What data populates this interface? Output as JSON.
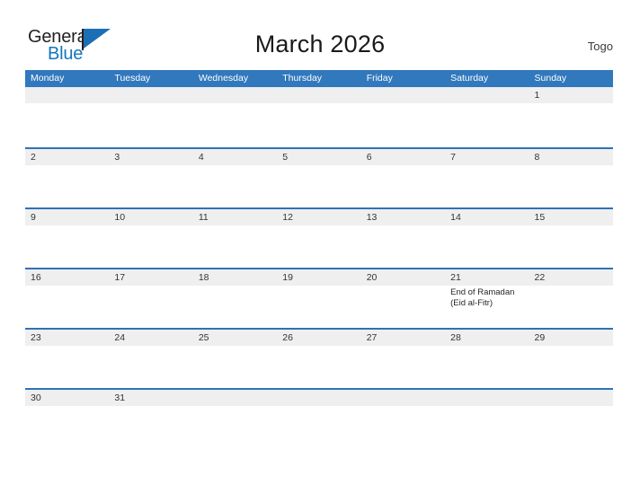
{
  "header": {
    "logo_primary": "General",
    "logo_secondary": "Blue",
    "title": "March 2026",
    "country": "Togo"
  },
  "colors": {
    "header_blue": "#3178bd",
    "row_divider_blue": "#2f72b5",
    "daynum_band": "#efeff0",
    "logo_blue": "#1276bd",
    "text_dark": "#333333"
  },
  "calendar": {
    "weekdays": [
      "Monday",
      "Tuesday",
      "Wednesday",
      "Thursday",
      "Friday",
      "Saturday",
      "Sunday"
    ],
    "weeks": [
      {
        "days": [
          {
            "num": "",
            "event": ""
          },
          {
            "num": "",
            "event": ""
          },
          {
            "num": "",
            "event": ""
          },
          {
            "num": "",
            "event": ""
          },
          {
            "num": "",
            "event": ""
          },
          {
            "num": "",
            "event": ""
          },
          {
            "num": "1",
            "event": ""
          }
        ]
      },
      {
        "days": [
          {
            "num": "2",
            "event": ""
          },
          {
            "num": "3",
            "event": ""
          },
          {
            "num": "4",
            "event": ""
          },
          {
            "num": "5",
            "event": ""
          },
          {
            "num": "6",
            "event": ""
          },
          {
            "num": "7",
            "event": ""
          },
          {
            "num": "8",
            "event": ""
          }
        ]
      },
      {
        "days": [
          {
            "num": "9",
            "event": ""
          },
          {
            "num": "10",
            "event": ""
          },
          {
            "num": "11",
            "event": ""
          },
          {
            "num": "12",
            "event": ""
          },
          {
            "num": "13",
            "event": ""
          },
          {
            "num": "14",
            "event": ""
          },
          {
            "num": "15",
            "event": ""
          }
        ]
      },
      {
        "days": [
          {
            "num": "16",
            "event": ""
          },
          {
            "num": "17",
            "event": ""
          },
          {
            "num": "18",
            "event": ""
          },
          {
            "num": "19",
            "event": ""
          },
          {
            "num": "20",
            "event": ""
          },
          {
            "num": "21",
            "event": "End of Ramadan\n(Eid al-Fitr)"
          },
          {
            "num": "22",
            "event": ""
          }
        ]
      },
      {
        "days": [
          {
            "num": "23",
            "event": ""
          },
          {
            "num": "24",
            "event": ""
          },
          {
            "num": "25",
            "event": ""
          },
          {
            "num": "26",
            "event": ""
          },
          {
            "num": "27",
            "event": ""
          },
          {
            "num": "28",
            "event": ""
          },
          {
            "num": "29",
            "event": ""
          }
        ]
      },
      {
        "days": [
          {
            "num": "30",
            "event": ""
          },
          {
            "num": "31",
            "event": ""
          },
          {
            "num": "",
            "event": ""
          },
          {
            "num": "",
            "event": ""
          },
          {
            "num": "",
            "event": ""
          },
          {
            "num": "",
            "event": ""
          },
          {
            "num": "",
            "event": ""
          }
        ]
      }
    ]
  }
}
